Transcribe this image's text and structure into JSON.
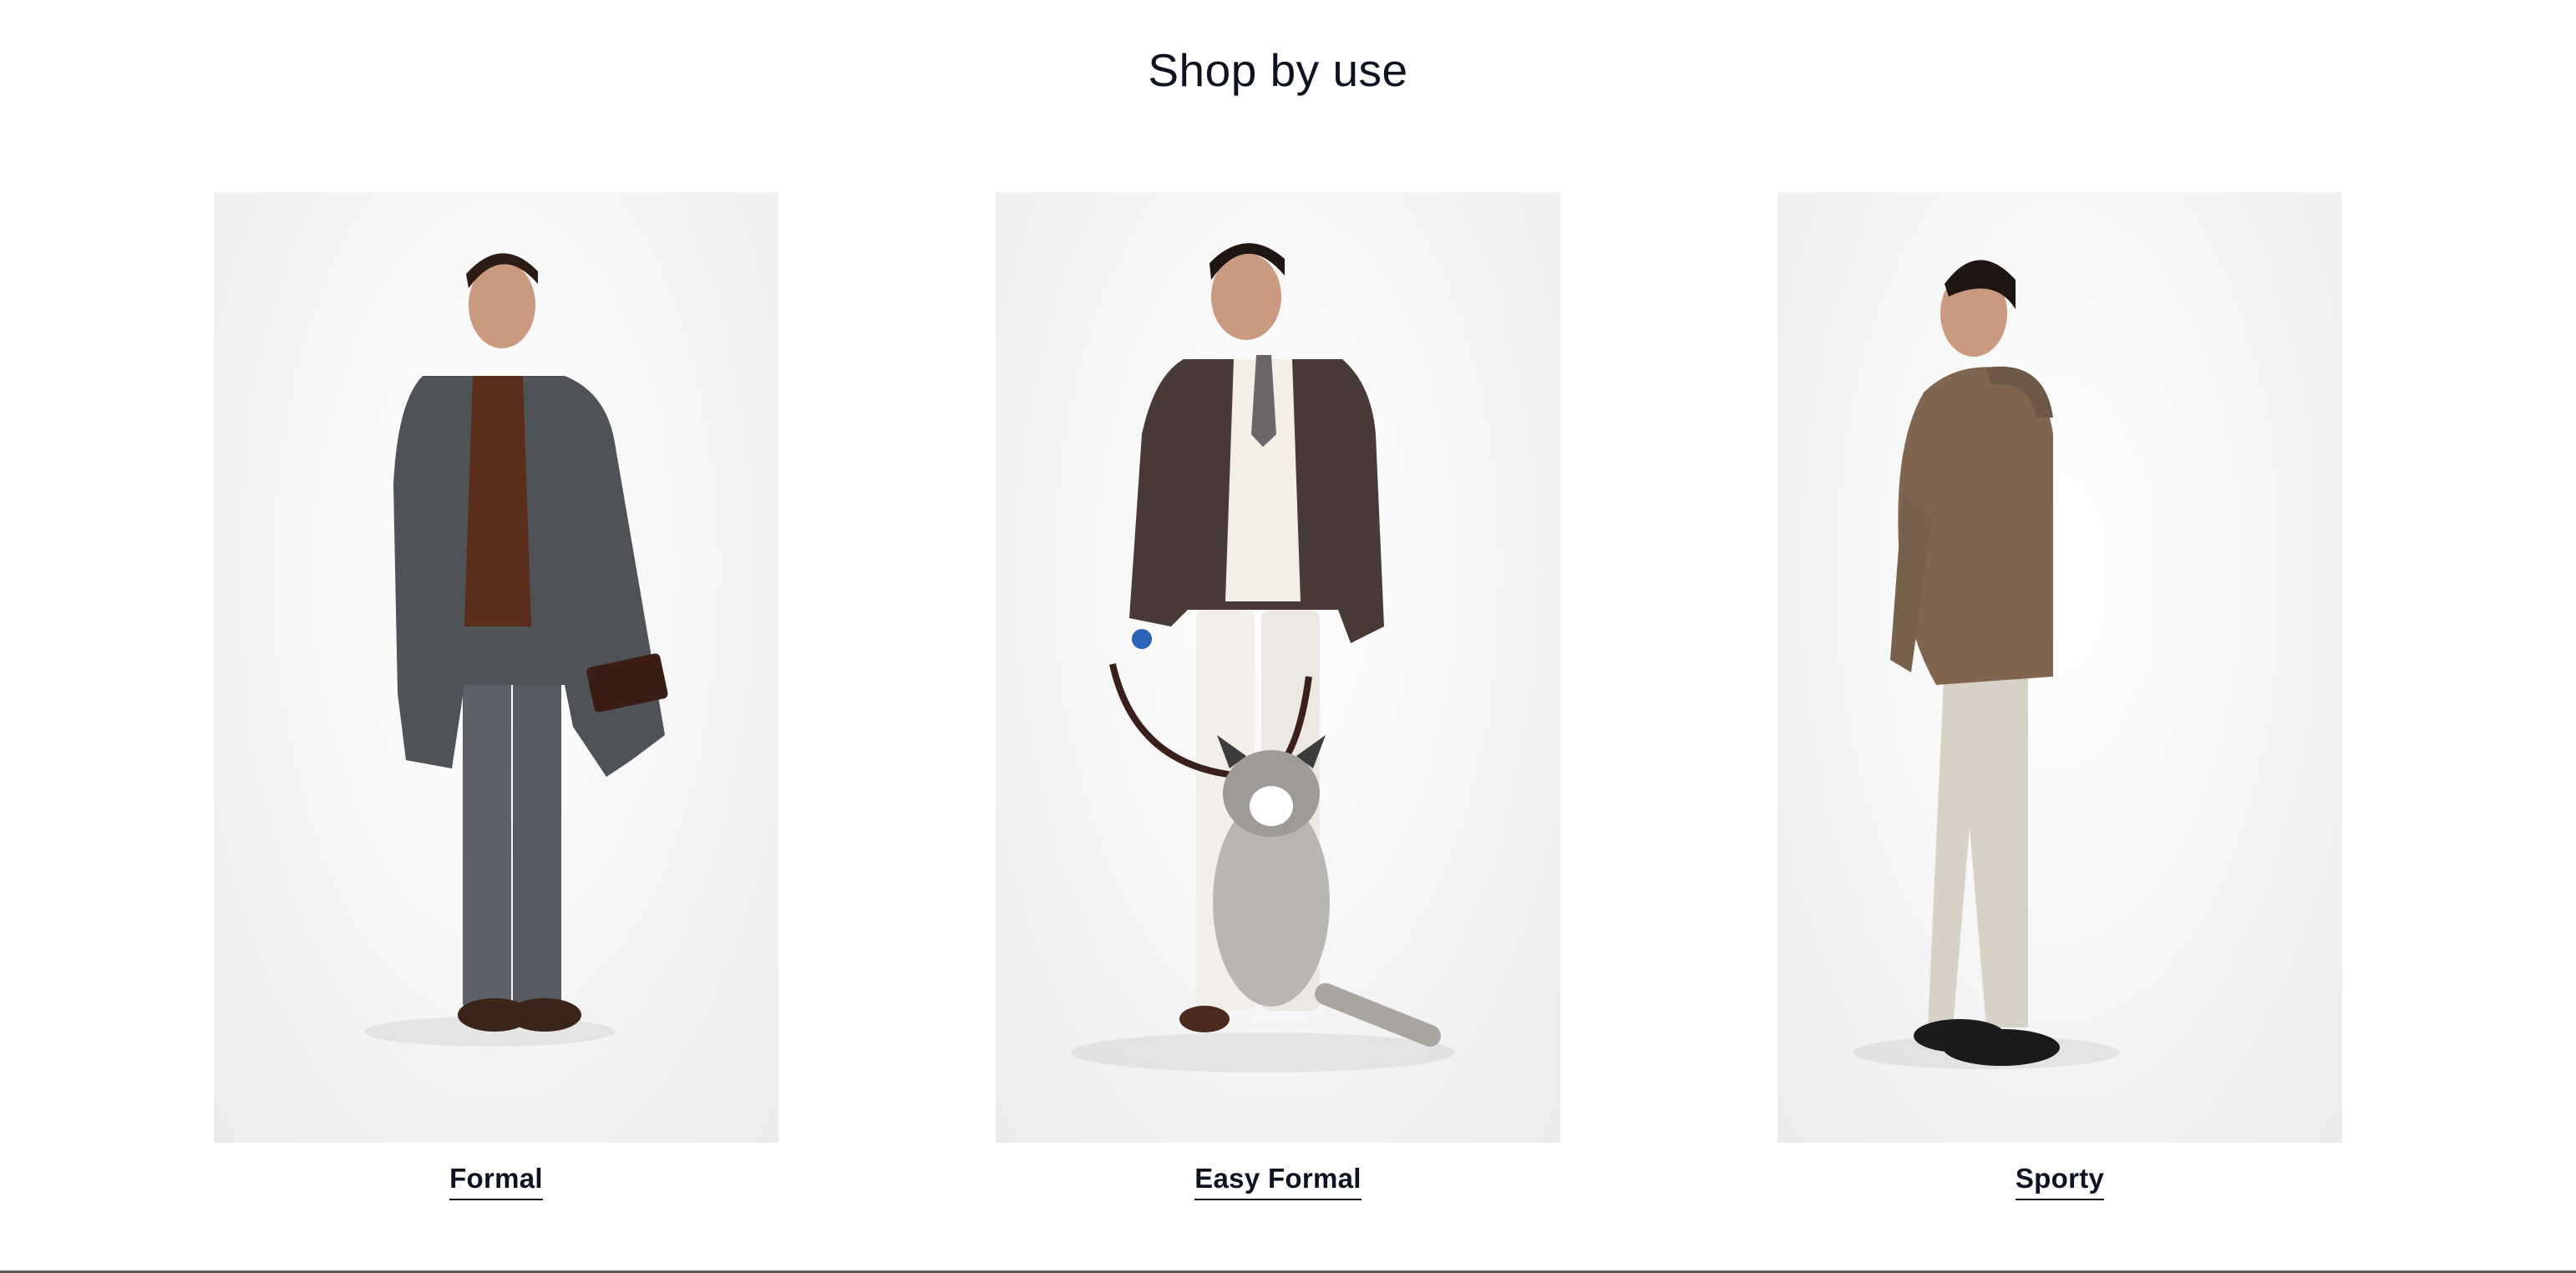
{
  "section": {
    "title": "Shop by use"
  },
  "categories": [
    {
      "label": "Formal",
      "image": "man-in-grey-overcoat-photo"
    },
    {
      "label": "Easy Formal",
      "image": "man-in-brown-blazer-with-dog-photo"
    },
    {
      "label": "Sporty",
      "image": "man-in-hooded-jacket-side-view-photo"
    }
  ],
  "colors": {
    "text": "#0f1320",
    "background": "#ffffff"
  }
}
